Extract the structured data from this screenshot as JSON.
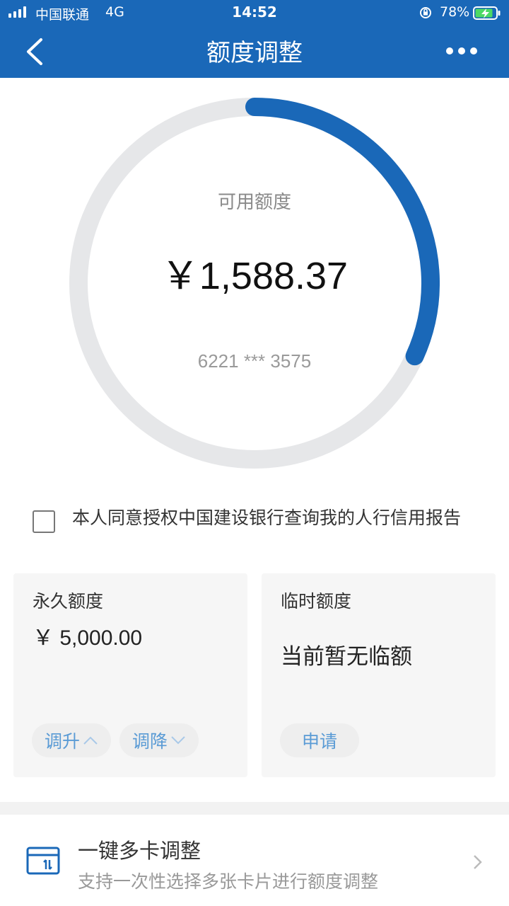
{
  "status_bar": {
    "carrier": "中国联通",
    "network": "4G",
    "time": "14:52",
    "battery_percent": "78%"
  },
  "nav": {
    "title": "额度调整",
    "back_icon": "chevron-left-icon",
    "more_icon": "more-dots-icon"
  },
  "credit_ring": {
    "label": "可用额度",
    "amount": "￥1,588.37",
    "card_number": "6221 *** 3575",
    "available_fraction": 0.318,
    "progress_color": "#1a68b8",
    "track_color": "#e6e7e9"
  },
  "consent": {
    "checked": false,
    "text": "本人同意授权中国建设银行查询我的人行信用报告"
  },
  "permanent_limit": {
    "heading": "永久额度",
    "value": "￥ 5,000.00",
    "increase_label": "调升",
    "decrease_label": "调降"
  },
  "temporary_limit": {
    "heading": "临时额度",
    "status": "当前暂无临额",
    "apply_label": "申请"
  },
  "multi_card": {
    "title": "一键多卡调整",
    "subtitle": "支持一次性选择多张卡片进行额度调整"
  },
  "colors": {
    "brand_blue": "#1a68b8",
    "link_blue": "#5a9bd5"
  }
}
